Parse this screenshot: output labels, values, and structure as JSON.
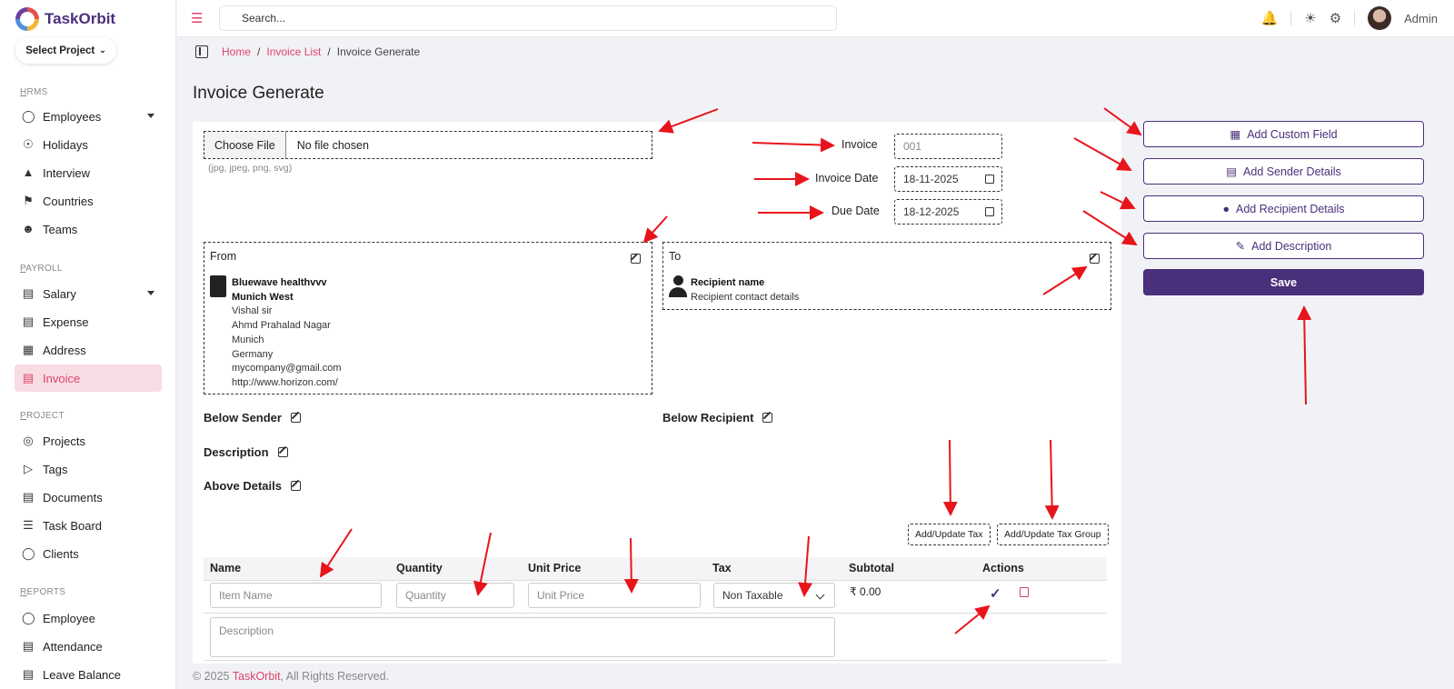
{
  "app": {
    "name": "TaskOrbit",
    "select_project": "Select Project"
  },
  "sidebar": {
    "sections": [
      {
        "label": "HRMS"
      },
      {
        "label": "PAYROLL"
      },
      {
        "label": "PROJECT"
      },
      {
        "label": "REPORTS"
      }
    ],
    "hrms": [
      "Employees",
      "Holidays",
      "Interview",
      "Countries",
      "Teams"
    ],
    "payroll": [
      "Salary",
      "Expense",
      "Address",
      "Invoice"
    ],
    "project": [
      "Projects",
      "Tags",
      "Documents",
      "Task Board",
      "Clients"
    ],
    "reports": [
      "Employee",
      "Attendance",
      "Leave Balance"
    ]
  },
  "topbar": {
    "search_placeholder": "Search...",
    "user": "Admin"
  },
  "breadcrumb": {
    "home": "Home",
    "list": "Invoice List",
    "current": "Invoice Generate"
  },
  "page": {
    "title": "Invoice Generate"
  },
  "form": {
    "file_button": "Choose File",
    "file_text": "No file chosen",
    "file_hint": "(jpg, jpeg, png, svg)",
    "invoice_label": "Invoice",
    "invoice_value": "001",
    "invoice_date_label": "Invoice Date",
    "invoice_date": "18-11-2025",
    "due_date_label": "Due Date",
    "due_date": "18-12-2025"
  },
  "from": {
    "heading": "From",
    "company": "Bluewave healthvvv",
    "branch": "Munich West",
    "lines": [
      "Vishal sir",
      "Ahmd Prahalad Nagar",
      "Munich",
      "Germany",
      "mycompany@gmail.com",
      "http://www.horizon.com/"
    ]
  },
  "to": {
    "heading": "To",
    "name": "Recipient name",
    "contact": "Recipient contact details"
  },
  "sections": {
    "below_sender": "Below Sender",
    "below_recipient": "Below Recipient",
    "description": "Description",
    "above_details": "Above Details"
  },
  "tax": {
    "add_tax": "Add/Update Tax",
    "add_group": "Add/Update Tax Group"
  },
  "table": {
    "headers": [
      "Name",
      "Quantity",
      "Unit Price",
      "Tax",
      "Subtotal",
      "Actions"
    ],
    "placeholders": {
      "name": "Item Name",
      "quantity": "Quantity",
      "unit_price": "Unit Price",
      "description": "Description"
    },
    "tax_value": "Non Taxable",
    "subtotal": "₹ 0.00"
  },
  "actions": {
    "custom_field": "Add Custom Field",
    "sender": "Add Sender Details",
    "recipient": "Add Recipient Details",
    "description": "Add Description",
    "save": "Save"
  },
  "footer": {
    "prefix": "© 2025",
    "brand": "TaskOrbit",
    "suffix": ", All Rights Reserved."
  },
  "colors": {
    "brand": "#4a2f7a",
    "accent": "#e0436b",
    "arrow": "#e8141c"
  }
}
